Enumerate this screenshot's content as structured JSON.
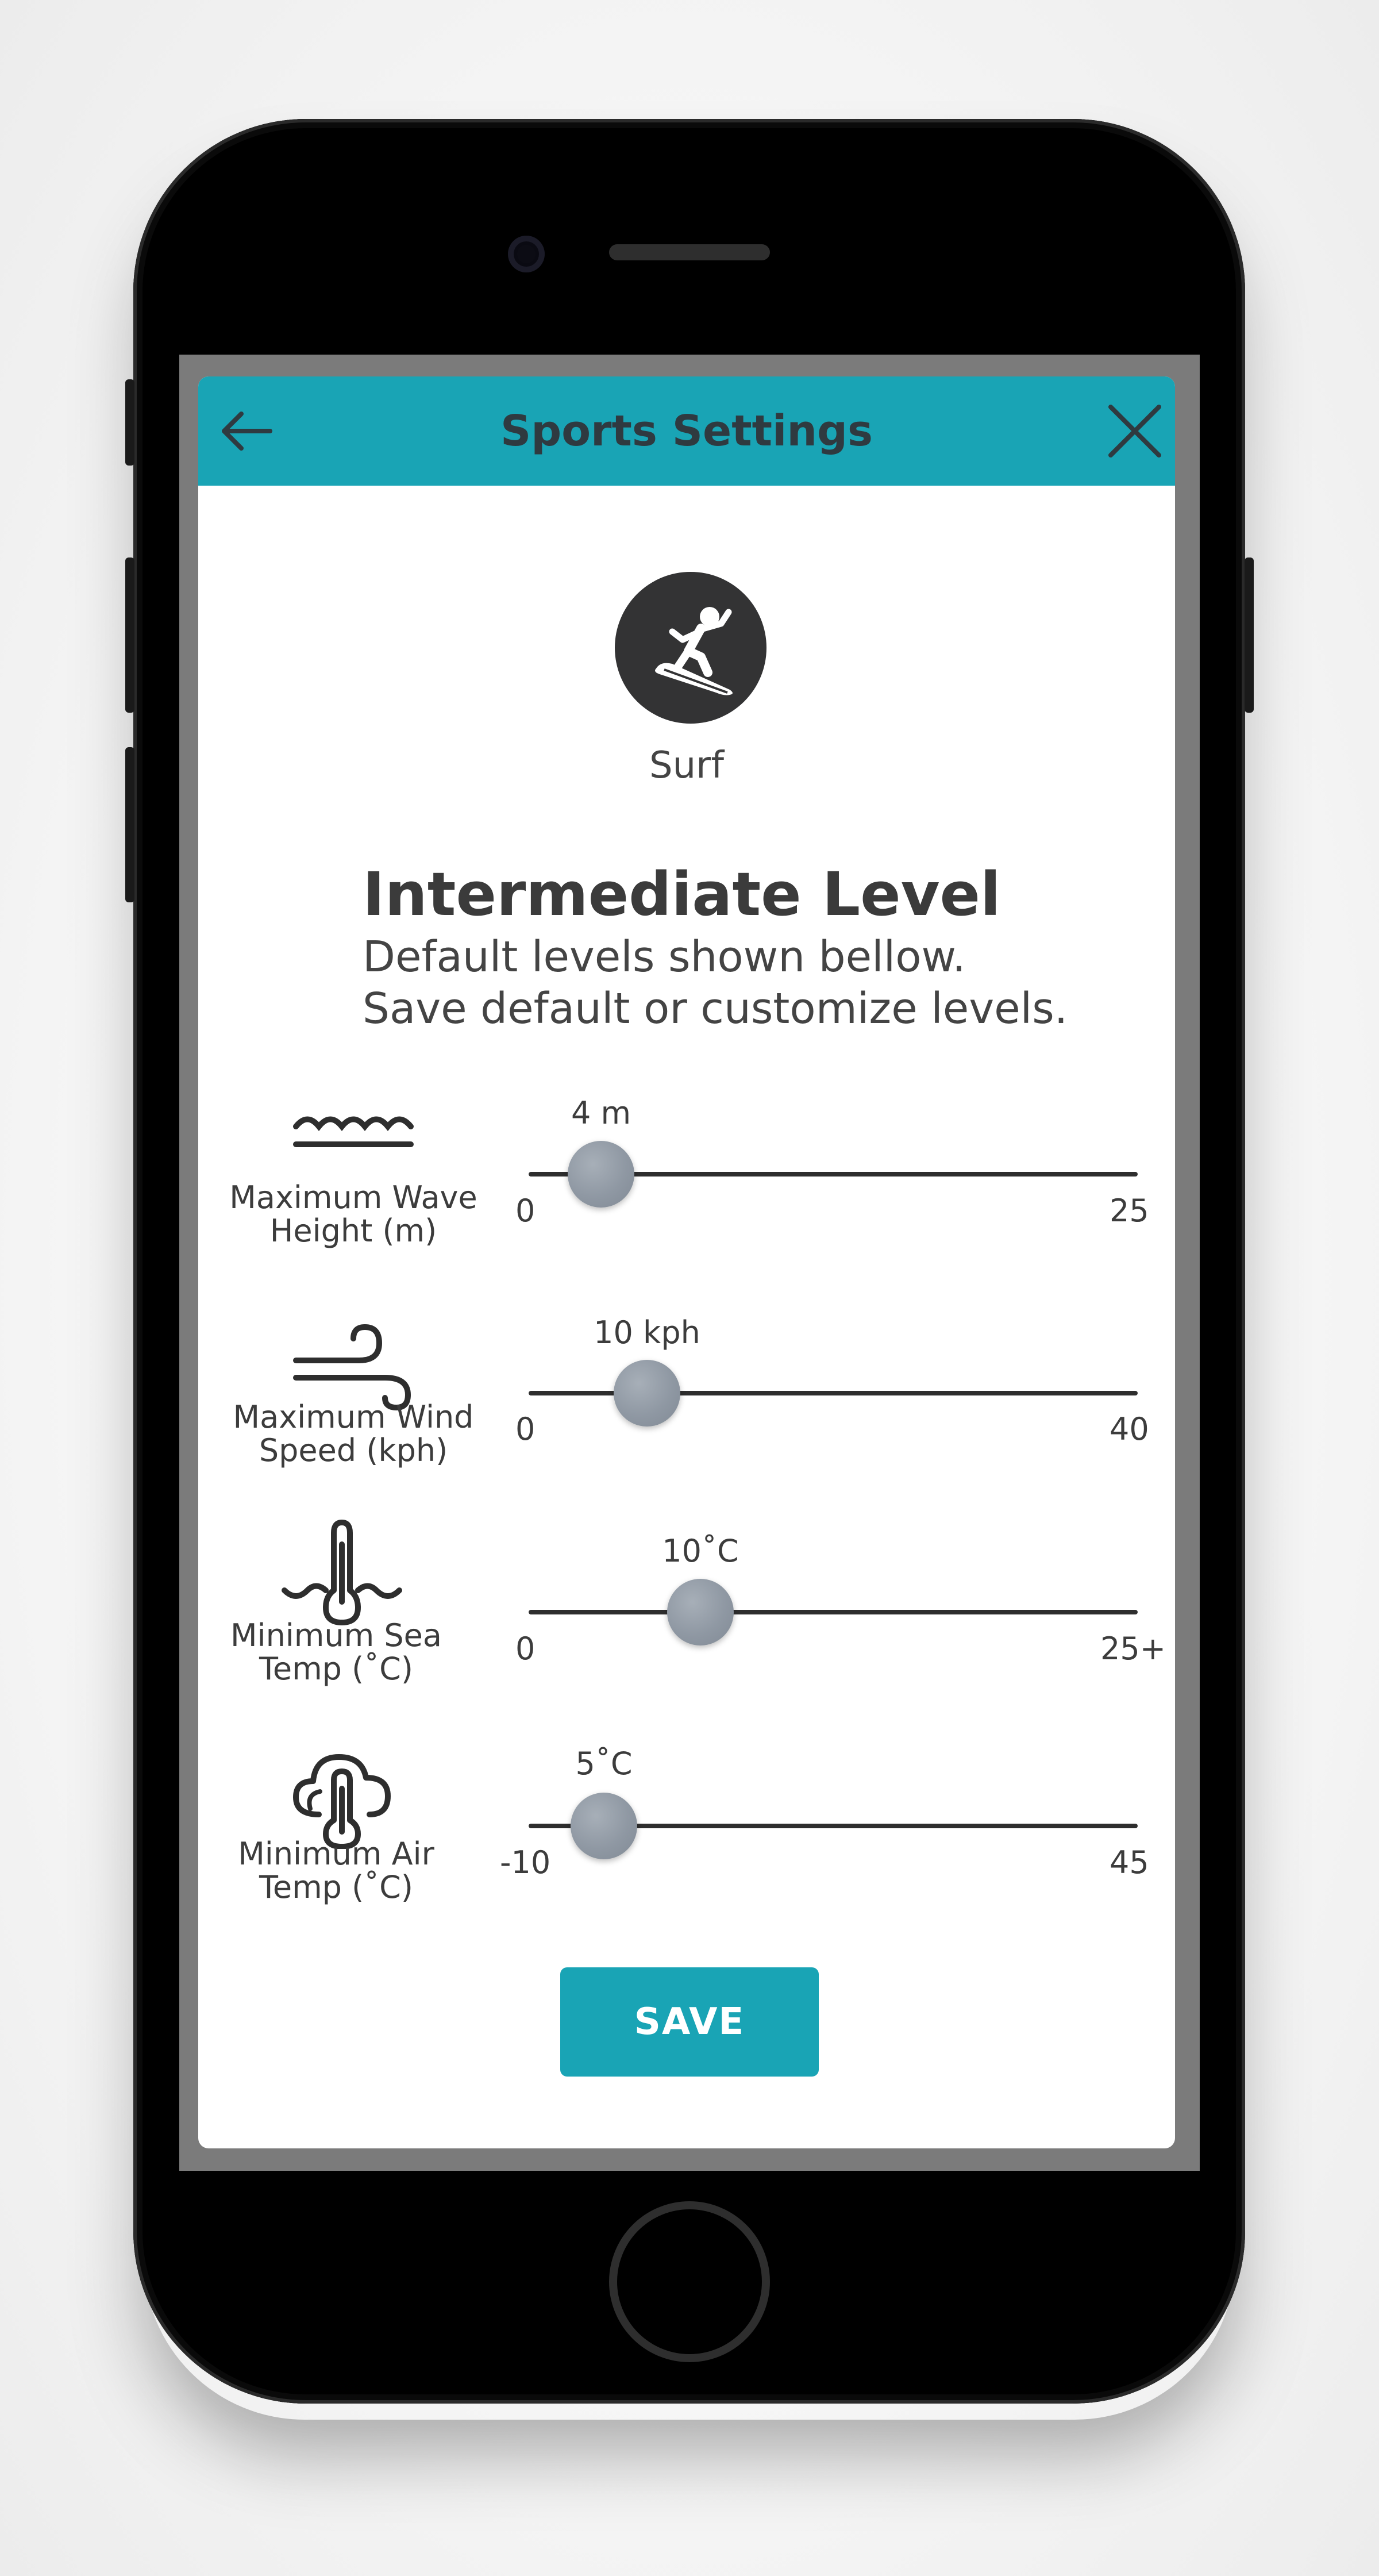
{
  "header": {
    "title": "Sports Settings"
  },
  "sport": {
    "name": "Surf",
    "icon": "surfer-icon"
  },
  "level": {
    "title": "Intermediate Level",
    "line1": "Default levels shown bellow.",
    "line2": "Save default or customize levels."
  },
  "sliders": [
    {
      "label1": "Maximum Wave",
      "label2": "Height (m)",
      "icon": "wave-icon",
      "value": "4 m",
      "min": "0",
      "max": "25"
    },
    {
      "label1": "Maximum Wind",
      "label2": "Speed (kph)",
      "icon": "wind-icon",
      "value": "10 kph",
      "min": "0",
      "max": "40"
    },
    {
      "label1": "Minimum Sea",
      "label2": "Temp (˚C)",
      "icon": "sea-thermometer-icon",
      "value": "10˚C",
      "min": "0",
      "max": "25+"
    },
    {
      "label1": "Minimum Air",
      "label2": "Temp (˚C)",
      "icon": "cloud-thermometer-icon",
      "value": "5˚C",
      "min": "-10",
      "max": "45"
    }
  ],
  "save_label": "SAVE",
  "colors": {
    "accent": "#19a4b5",
    "knob": "#8f98a3"
  }
}
